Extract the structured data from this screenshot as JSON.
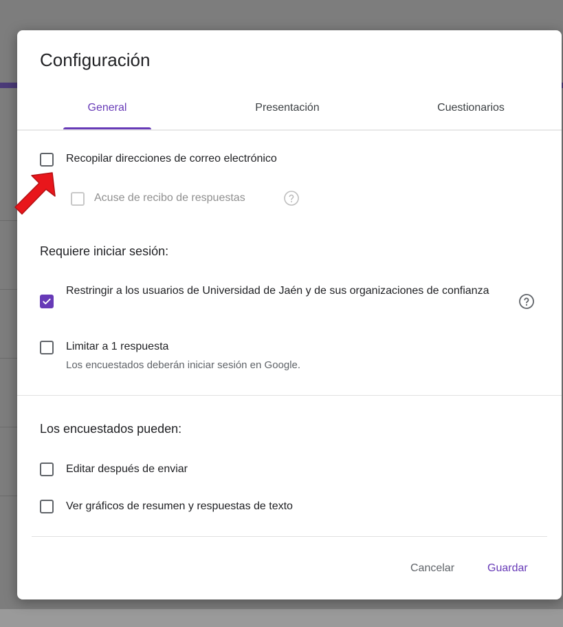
{
  "dialog": {
    "title": "Configuración",
    "tabs": [
      {
        "label": "General",
        "active": true
      },
      {
        "label": "Presentación",
        "active": false
      },
      {
        "label": "Cuestionarios",
        "active": false
      }
    ],
    "options_general": {
      "collect_emails": {
        "label": "Recopilar direcciones de correo electrónico",
        "checked": false
      },
      "response_receipts": {
        "label": "Acuse de recibo de respuestas",
        "checked": false,
        "disabled": true
      }
    },
    "sign_in_section": {
      "heading": "Requiere iniciar sesión:",
      "restrict_users": {
        "label": "Restringir a los usuarios de Universidad de Jaén y de sus organizaciones de confianza",
        "checked": true
      },
      "limit_one": {
        "label": "Limitar a 1 respuesta",
        "sublabel": "Los encuestados deberán iniciar sesión en Google.",
        "checked": false
      }
    },
    "respondents_section": {
      "heading": "Los encuestados pueden:",
      "edit_after_submit": {
        "label": "Editar después de enviar",
        "checked": false
      },
      "see_summary": {
        "label": "Ver gráficos de resumen y respuestas de texto",
        "checked": false
      }
    },
    "actions": {
      "cancel": "Cancelar",
      "save": "Guardar"
    }
  },
  "colors": {
    "accent": "#673ab7",
    "annotation_arrow": "#e8161b"
  },
  "icons": {
    "help": "help-circle-icon",
    "check": "check-icon",
    "annotation": "red-arrow-annotation"
  }
}
